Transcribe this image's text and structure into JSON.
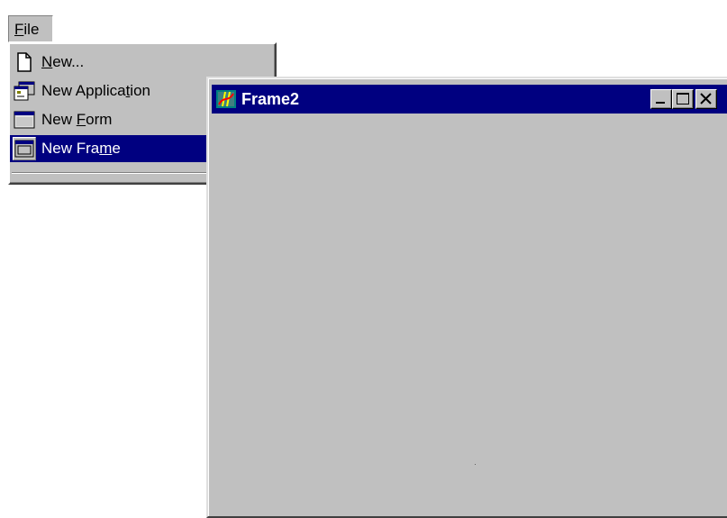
{
  "menu_bar": {
    "file_label_underlined": "F",
    "file_label_rest": "ile"
  },
  "file_menu": {
    "items": [
      {
        "pre": "",
        "accel": "N",
        "post": "ew...",
        "icon": "blank-document-icon"
      },
      {
        "pre": "New Applica",
        "accel": "t",
        "post": "ion",
        "icon": "new-application-icon"
      },
      {
        "pre": "New ",
        "accel": "F",
        "post": "orm",
        "icon": "new-form-icon"
      },
      {
        "pre": "New Fra",
        "accel": "m",
        "post": "e",
        "icon": "new-frame-icon",
        "highlighted": true
      }
    ]
  },
  "frame2": {
    "title": "Frame2",
    "icon": "application-icon"
  },
  "colors": {
    "menu_face": "#c0c0c0",
    "highlight": "#000080",
    "highlight_text": "#ffffff",
    "titlebar": "#000080"
  }
}
